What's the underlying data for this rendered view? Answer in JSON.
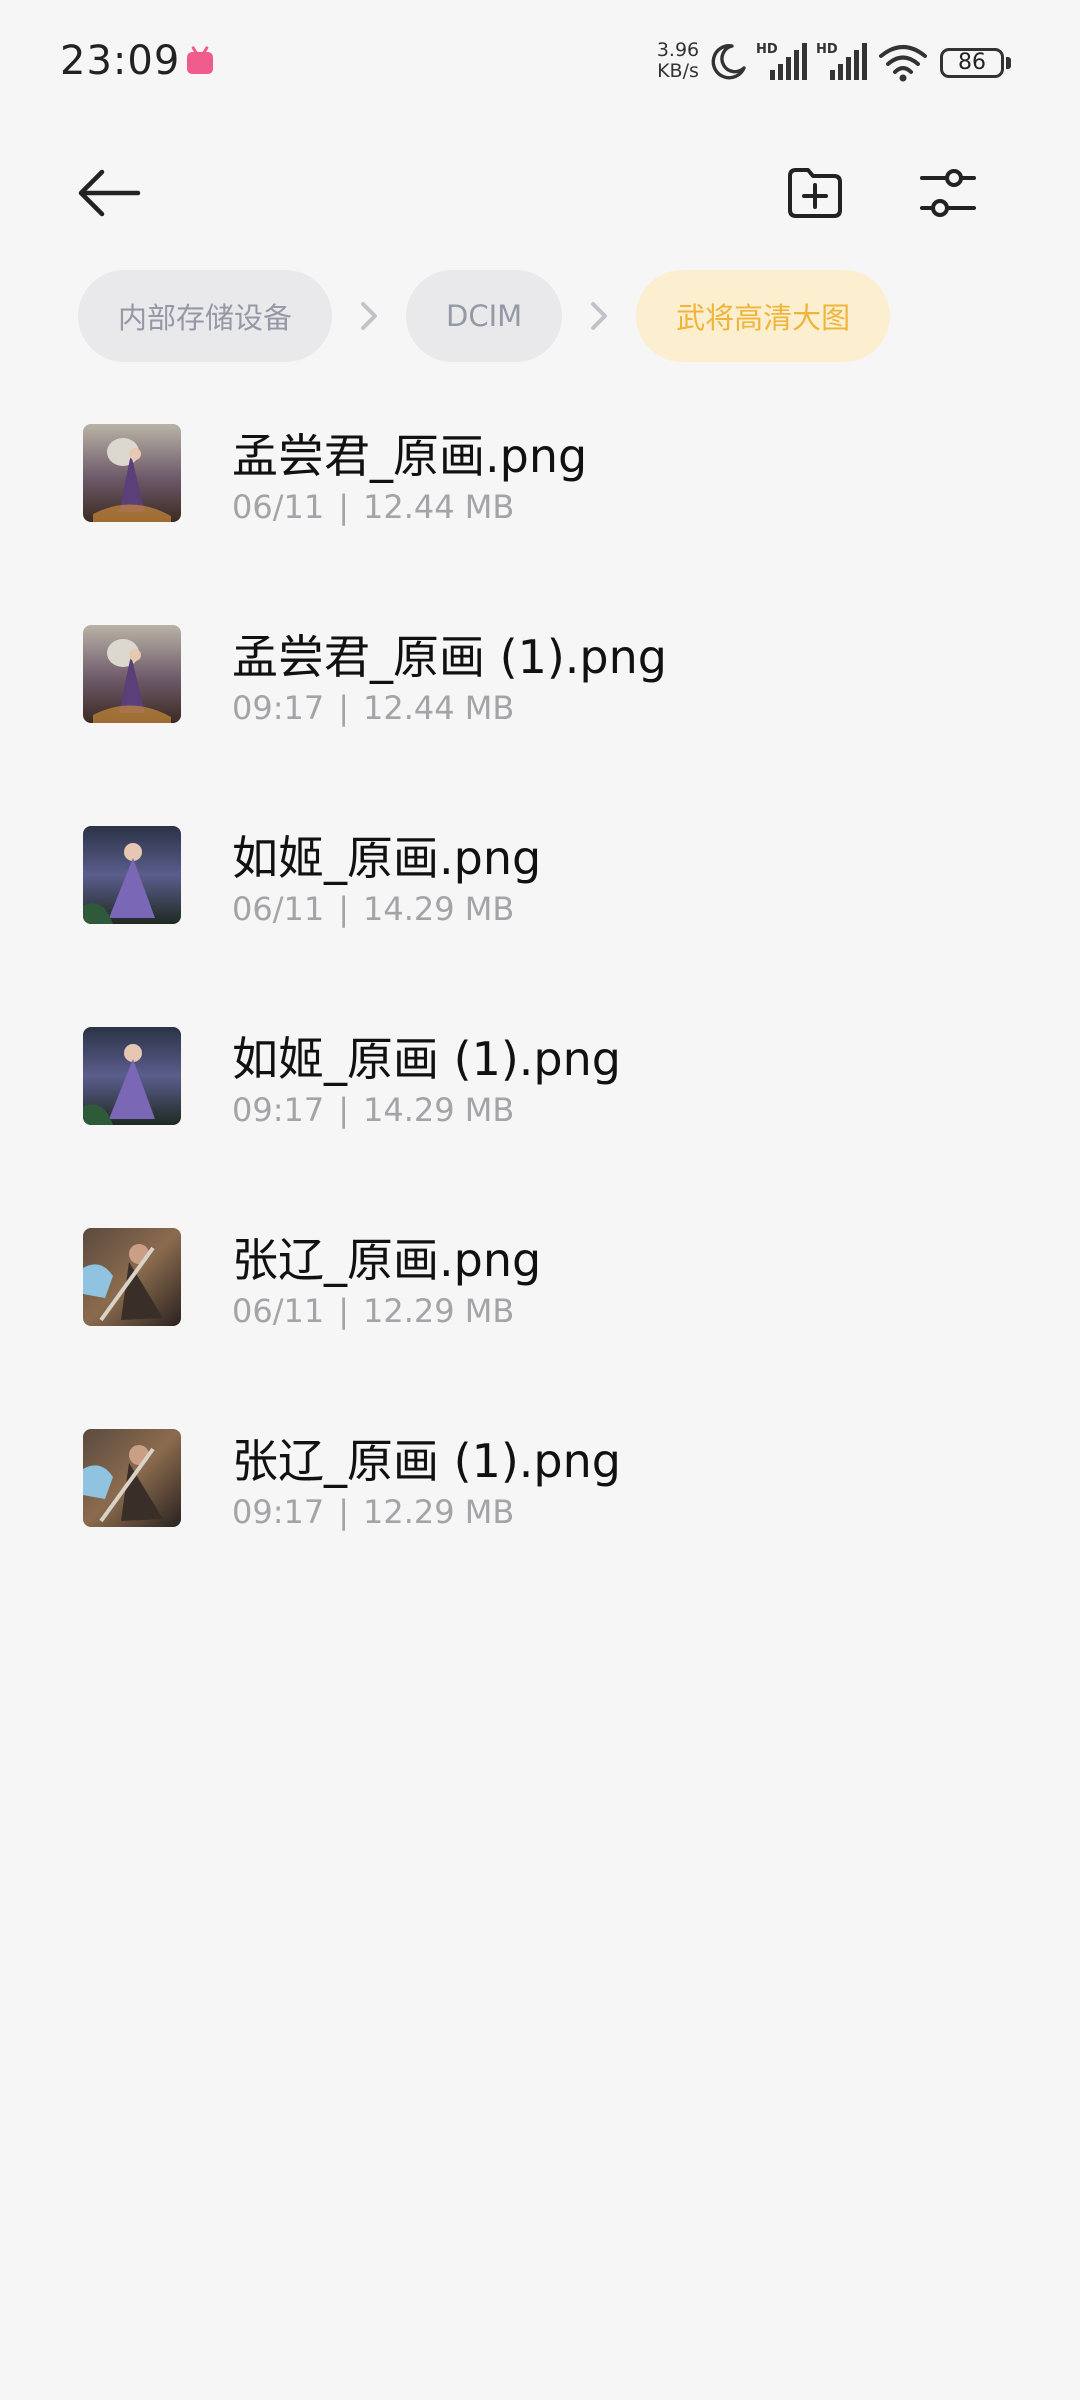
{
  "status_bar": {
    "time": "23:09",
    "net_speed_value": "3.96",
    "net_speed_unit": "KB/s",
    "battery": "86",
    "icons": [
      "bilibili-icon",
      "moon-icon",
      "hd-signal-icon",
      "hd-signal-icon",
      "wifi-icon",
      "battery-icon"
    ]
  },
  "toolbar": {
    "back_icon": "arrow-left-icon",
    "new_folder_icon": "folder-plus-icon",
    "filter_icon": "sliders-icon"
  },
  "breadcrumb": {
    "items": [
      "内部存储设备",
      "DCIM",
      "武将高清大图"
    ],
    "separator_icon": "chevron-right-icon"
  },
  "files": [
    {
      "name": "孟尝君_原画.png",
      "date": "06/11",
      "size": "12.44 MB"
    },
    {
      "name": "孟尝君_原画 (1).png",
      "date": "09:17",
      "size": "12.44 MB"
    },
    {
      "name": "如姬_原画.png",
      "date": "06/11",
      "size": "14.29 MB"
    },
    {
      "name": "如姬_原画 (1).png",
      "date": "09:17",
      "size": "14.29 MB"
    },
    {
      "name": "张辽_原画.png",
      "date": "06/11",
      "size": "12.29 MB"
    },
    {
      "name": "张辽_原画 (1).png",
      "date": "09:17",
      "size": "12.29 MB"
    }
  ],
  "colors": {
    "background": "#f6f6f6",
    "crumb_bg": "#e9e9ec",
    "crumb_text": "#9599a6",
    "crumb_active_bg": "#fcefd0",
    "crumb_active_text": "#f0b43a"
  }
}
